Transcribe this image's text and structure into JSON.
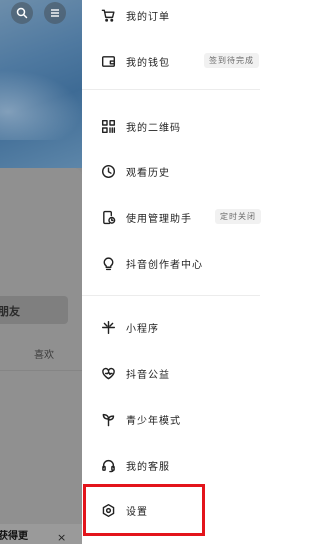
{
  "background": {
    "friends_label": "朋友",
    "likes_label": "喜欢",
    "bottom_text": "获得更",
    "close_symbol": "×",
    "top_icons": [
      "search-icon",
      "menu-icon"
    ]
  },
  "drawer": {
    "items": [
      {
        "label": "我的订单",
        "icon": "cart-icon"
      },
      {
        "label": "我的钱包",
        "icon": "wallet-icon",
        "badge": "签到待完成"
      },
      {
        "label": "我的二维码",
        "icon": "qr-code-icon"
      },
      {
        "label": "观看历史",
        "icon": "clock-icon"
      },
      {
        "label": "使用管理助手",
        "icon": "phone-timer-icon",
        "badge": "定时关闭"
      },
      {
        "label": "抖音创作者中心",
        "icon": "lightbulb-icon"
      },
      {
        "label": "小程序",
        "icon": "mini-program-icon"
      },
      {
        "label": "抖音公益",
        "icon": "charity-heart-icon"
      },
      {
        "label": "青少年模式",
        "icon": "sprout-icon"
      },
      {
        "label": "我的客服",
        "icon": "headset-icon"
      },
      {
        "label": "设置",
        "icon": "settings-hexagon-icon"
      }
    ]
  },
  "colors": {
    "highlight": "#e3141b",
    "overlay": "#8d8d8d"
  }
}
